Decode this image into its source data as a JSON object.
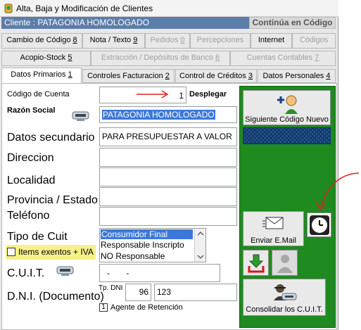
{
  "window": {
    "title": "Alta, Baja y Modificación de Clientes"
  },
  "header": {
    "client_label": "Cliente : PATAGONIA HOMOLOGADO",
    "continua_label": "Continúa en Código"
  },
  "tabs_row1": [
    {
      "label": "Cambio de Código 8",
      "disabled": false
    },
    {
      "label": "Nota / Texto 9",
      "disabled": false
    },
    {
      "label": "Pedidos 0",
      "disabled": true
    },
    {
      "label": "Percepciones",
      "disabled": true
    },
    {
      "label": "Internet",
      "disabled": false
    },
    {
      "label": "Códigos",
      "disabled": true
    }
  ],
  "tabs_row2": [
    {
      "label": "Acopio-Stock 5",
      "disabled": false
    },
    {
      "label": "Extracción / Depósitos de Banco 6",
      "disabled": true
    },
    {
      "label": "Cuentas Contables 7",
      "disabled": true
    }
  ],
  "tabs_row3": [
    {
      "label": "Datos Primarios 1",
      "active": true
    },
    {
      "label": "Controles Facturacion 2",
      "active": false
    },
    {
      "label": "Control de Créditos 3",
      "active": false
    },
    {
      "label": "Datos Personales 4",
      "active": false
    }
  ],
  "form": {
    "codigo_label": "Código de Cuenta",
    "codigo_value": "1",
    "desplegar_label": "Desplegar",
    "razon_label": "Razón Social",
    "razon_value": "PATAGONIA HOMOLOGADO",
    "datos_sec_label": "Datos secundario",
    "datos_sec_value": "PARA PRESUPUESTAR A VALOR",
    "direccion_label": "Direccion",
    "localidad_label": "Localidad",
    "provincia_label": "Provincia / Estado",
    "telefono_label": "Teléfono",
    "tipo_cuit_label": "Tipo de Cuit",
    "tipo_cuit_options": [
      "Consumidor Final",
      "Responsable Inscripto",
      "NO Responsable"
    ],
    "tipo_cuit_selected": "Consumidor Final",
    "items_exentos_label": "Items exentos + IVA",
    "items_exentos_checked": false,
    "cuit_label": "C.U.I.T.",
    "cuit_value": "-       -",
    "dni_label": "D.N.I. (Documento)",
    "tp_dni_label": "Tp. DNI",
    "tp_dni_value": "96",
    "dni_value": "123",
    "agente_num": "1",
    "agente_label": "Agente de Retención"
  },
  "side": {
    "siguiente_label": "Siguiente Código Nuevo",
    "enviar_label": "Enviar E.Mail",
    "consolidar_label": "Consolidar los C.U.I.T."
  },
  "colors": {
    "accent_blue": "#3b78d8",
    "green_panel": "#1f8a1f",
    "red_annotation": "#e02020",
    "client_bar": "#5b7da8"
  }
}
